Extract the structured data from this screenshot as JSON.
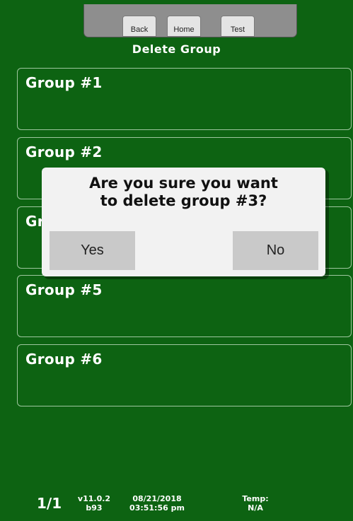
{
  "nav": {
    "back_label": "Back",
    "home_label": "Home",
    "test_label": "Test"
  },
  "page_title": "Delete Group",
  "groups": [
    {
      "label": "Group #1"
    },
    {
      "label": "Group #2"
    },
    {
      "label": "Gr"
    },
    {
      "label": "Group #5"
    },
    {
      "label": "Group #6"
    }
  ],
  "dialog": {
    "message": "Are you sure you want\nto delete group #3?",
    "yes_label": "Yes",
    "no_label": "No"
  },
  "footer": {
    "page": "1/1",
    "version": "v11.0.2",
    "build": "b93",
    "date": "08/21/2018",
    "time": "03:51:56 pm",
    "temp_label": "Temp:",
    "temp_value": "N/A"
  },
  "colors": {
    "background": "#0d6312",
    "card_border": "#9ec79f",
    "dialog_bg": "#f2f2f2",
    "dialog_button": "#c9c9c9",
    "nav_bar": "#8e8e8e"
  }
}
